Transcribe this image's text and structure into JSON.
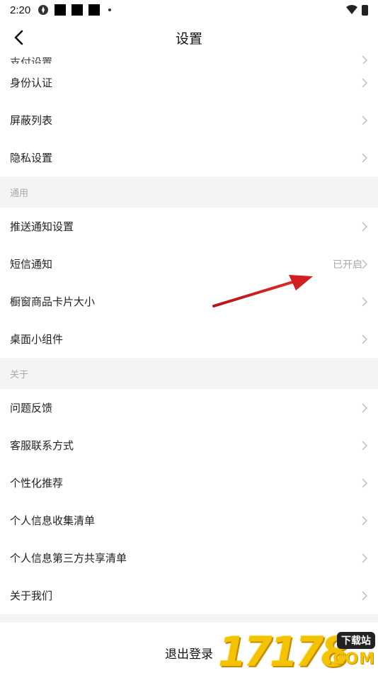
{
  "status": {
    "time": "2:20"
  },
  "nav": {
    "title": "设置"
  },
  "items_top": [
    {
      "label": "支付设置"
    },
    {
      "label": "身份认证"
    },
    {
      "label": "屏蔽列表"
    },
    {
      "label": "隐私设置"
    }
  ],
  "section_general": {
    "title": "通用"
  },
  "items_general": [
    {
      "label": "推送通知设置"
    },
    {
      "label": "短信通知",
      "value": "已开启"
    },
    {
      "label": "橱窗商品卡片大小"
    },
    {
      "label": "桌面小组件"
    }
  ],
  "section_about": {
    "title": "关于"
  },
  "items_about": [
    {
      "label": "问题反馈"
    },
    {
      "label": "客服联系方式"
    },
    {
      "label": "个性化推荐"
    },
    {
      "label": "个人信息收集清单"
    },
    {
      "label": "个人信息第三方共享清单"
    },
    {
      "label": "关于我们"
    }
  ],
  "logout": {
    "label": "退出登录"
  },
  "watermark": {
    "digits": "17178",
    "tag": "下载站",
    "domain": ".COM"
  },
  "colors": {
    "arrow": "#d21e1e",
    "watermark_yellow": "#f3c300",
    "section_bg": "#f4f4f4"
  }
}
